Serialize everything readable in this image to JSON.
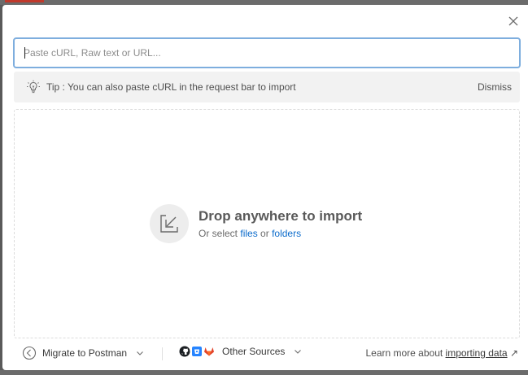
{
  "dialog": {
    "close_icon": "close-icon"
  },
  "input": {
    "placeholder": "Paste cURL, Raw text or URL...",
    "value": ""
  },
  "tip": {
    "icon": "lightbulb-icon",
    "text": "Tip : You can also paste cURL in the request bar to import",
    "dismiss": "Dismiss"
  },
  "dropzone": {
    "icon": "import-arrow-icon",
    "title": "Drop anywhere to import",
    "sub_prefix": "Or select",
    "files_link": "files",
    "or": "or",
    "folders_link": "folders"
  },
  "footer": {
    "migrate_label": "Migrate to Postman",
    "other_sources_label": "Other Sources",
    "learn_prefix": "Learn more about",
    "learn_link": "importing data",
    "learn_arrow": "↗"
  },
  "colors": {
    "accent_border": "#7eaede",
    "link": "#0b6bcb",
    "tip_bg": "#f2f2f2",
    "gitlab": "#e2432a",
    "bitbucket": "#2684ff"
  }
}
